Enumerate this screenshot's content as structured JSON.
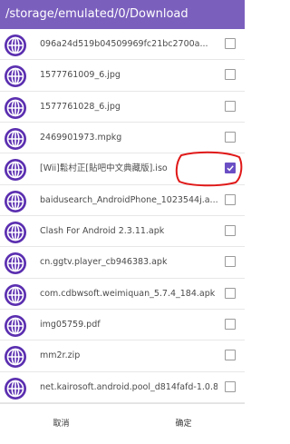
{
  "header": {
    "path": "/storage/emulated/0/Download"
  },
  "files": [
    {
      "name": "096a24d519b04509969fc21bc2700a...",
      "checked": false
    },
    {
      "name": "1577761009_6.jpg",
      "checked": false
    },
    {
      "name": "1577761028_6.jpg",
      "checked": false
    },
    {
      "name": "2469901973.mpkg",
      "checked": false
    },
    {
      "name": "[Wii]鬆村正[貼吧中文典藏版].iso",
      "checked": true
    },
    {
      "name": "baidusearch_AndroidPhone_1023544j.a...",
      "checked": false
    },
    {
      "name": "Clash For Android 2.3.11.apk",
      "checked": false
    },
    {
      "name": "cn.ggtv.player_cb946383.apk",
      "checked": false
    },
    {
      "name": "com.cdbwsoft.weimiquan_5.7.4_184.apk",
      "checked": false
    },
    {
      "name": "img05759.pdf",
      "checked": false
    },
    {
      "name": "mm2r.zip",
      "checked": false
    },
    {
      "name": "net.kairosoft.android.pool_d814fafd-1.0.8...",
      "checked": false
    }
  ],
  "footer": {
    "cancel_label": "取消",
    "ok_label": "确定"
  },
  "colors": {
    "accent": "#7b5fbd",
    "globe": "#5b2fb0",
    "checkbox": "#6a4fc4",
    "annotation": "#e01818"
  },
  "icons": {
    "file": "globe-icon",
    "check": "checkmark-icon"
  }
}
